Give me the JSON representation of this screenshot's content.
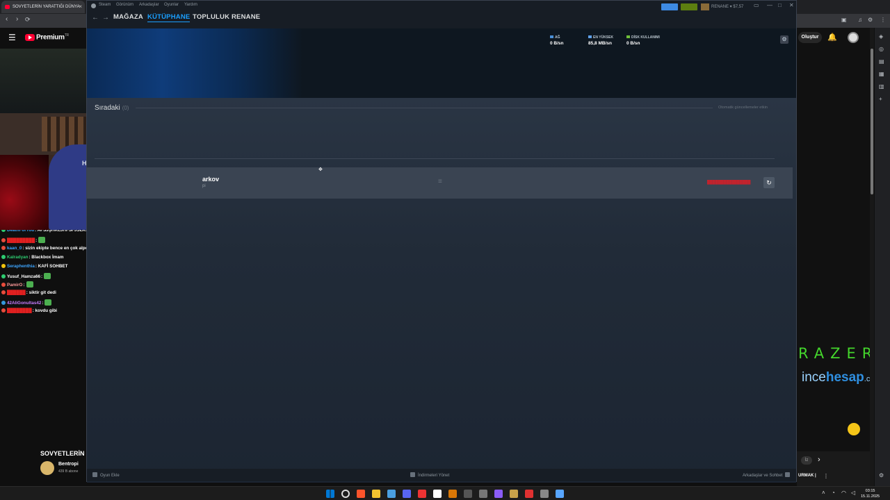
{
  "browser": {
    "tab_title": "SOVYETLERİN YARATTIĞI DÜNYA",
    "tab_close": "×",
    "nav_back": "‹",
    "nav_forward": "›",
    "nav_reload": "⟳"
  },
  "youtube": {
    "menu": "☰",
    "logo_text": "Premium",
    "logo_sup": "TR",
    "create_label": "Oluştur",
    "bell": "🔔"
  },
  "sponsors": {
    "razer": "RAZER",
    "incehesap_pre": "ince",
    "incehesap_bold": "hesap",
    "incehesap_suffix": ".com"
  },
  "chat": [
    {
      "user": "DeathForYou",
      "text": ": AFSJŞHKLJHFSFJSLKJKSKFASJLKFASJKFASFASLKS",
      "color": "#3ea6ff",
      "badge": "#2ecc71"
    },
    {
      "user": "█████████",
      "text": ":",
      "color": "#e02020",
      "badge": "#e74c3c",
      "emote": true
    },
    {
      "user": "kaan_0",
      "text": ": sizin ekipte bence en çok alperende imam tipi var",
      "color": "#3ea6ff",
      "badge": "#e74c3c"
    },
    {
      "user": "Kalradyan",
      "text": ": Blackbox İmam",
      "color": "#2ecc71",
      "badge": "#2ecc71"
    },
    {
      "user": "Seraphenthia",
      "text": ": KAFİ SOHBET",
      "color": "#3ea6ff",
      "badge": "#f1c40f"
    },
    {
      "user": "Yusuf_Hamza66",
      "text": ":",
      "color": "#ffffff",
      "badge": "#2ecc71",
      "emote": true
    },
    {
      "user": "PamirO",
      "text": ":",
      "color": "#ff9a9a",
      "badge": "#e74c3c",
      "emote": true
    },
    {
      "user": "██████",
      "text": ": siktir git dedi",
      "color": "#e02020",
      "badge": "#e74c3c"
    },
    {
      "user": "42AliGonultas42",
      "text": ":",
      "color": "#c77dff",
      "badge": "#3498db",
      "emote": true
    },
    {
      "user": "████████",
      "text": ": kovdu gibi",
      "color": "#e02020",
      "badge": "#e74c3c"
    }
  ],
  "channel": {
    "video_title": "SOVYETLERİN",
    "name": "Bentropi",
    "subs": "439 B abone"
  },
  "webcam": {
    "chair_logo": "HAWK"
  },
  "steam": {
    "titlebar_menu": [
      "Steam",
      "Görünüm",
      "Arkadaşlar",
      "Oyunlar",
      "Yardım"
    ],
    "account": "RENANE ▾ $7,57",
    "window_controls": [
      "▭",
      "—",
      "□",
      "✕"
    ],
    "nav": {
      "back": "←",
      "forward": "→",
      "tabs": [
        "MAĞAZA",
        "KÜTÜPHANE",
        "TOPLULUK",
        "RENANE"
      ]
    },
    "downloads": {
      "stats": [
        {
          "label": "AĞ",
          "value": "0 B/sn",
          "color": "#4b8fd6"
        },
        {
          "label": "EN YÜKSEK",
          "value": "85,8 MB/sn",
          "color": "#5fa0e8"
        },
        {
          "label": "DİSK KULLANIMI",
          "value": "0 B/sn",
          "color": "#6fbf3a"
        }
      ],
      "settings_icon": "⚙"
    },
    "queue": {
      "title": "Sıradaki",
      "count": "(0)",
      "auto_updates": "Otomatik güncellemeler etkin"
    },
    "game": {
      "title": "arkov",
      "subtitle": "pi",
      "drag_handle": "≡",
      "status": "████████████████",
      "restart_icon": "↻"
    },
    "footer": {
      "add_game": "Oyun Ekle",
      "manage_downloads": "İndirmeleri Yönet",
      "friends_chat": "Arkadaşlar ve Sohbet"
    }
  },
  "bottom_right": {
    "text": "URMAK |",
    "more": "⋮",
    "chevron": "›",
    "pill": "İz"
  },
  "taskbar": {
    "time": "03:15",
    "date": "15.11.2025",
    "icons": [
      "#0078d4",
      "#dddddd",
      "#fb542b",
      "#f4c430",
      "#4a9fe0",
      "#5865f2",
      "#e33",
      "#ffffff",
      "#d97706",
      "#555",
      "#777",
      "#8b5cf6",
      "#c8a24a",
      "#e03131",
      "#888",
      "#58a6ff"
    ]
  }
}
